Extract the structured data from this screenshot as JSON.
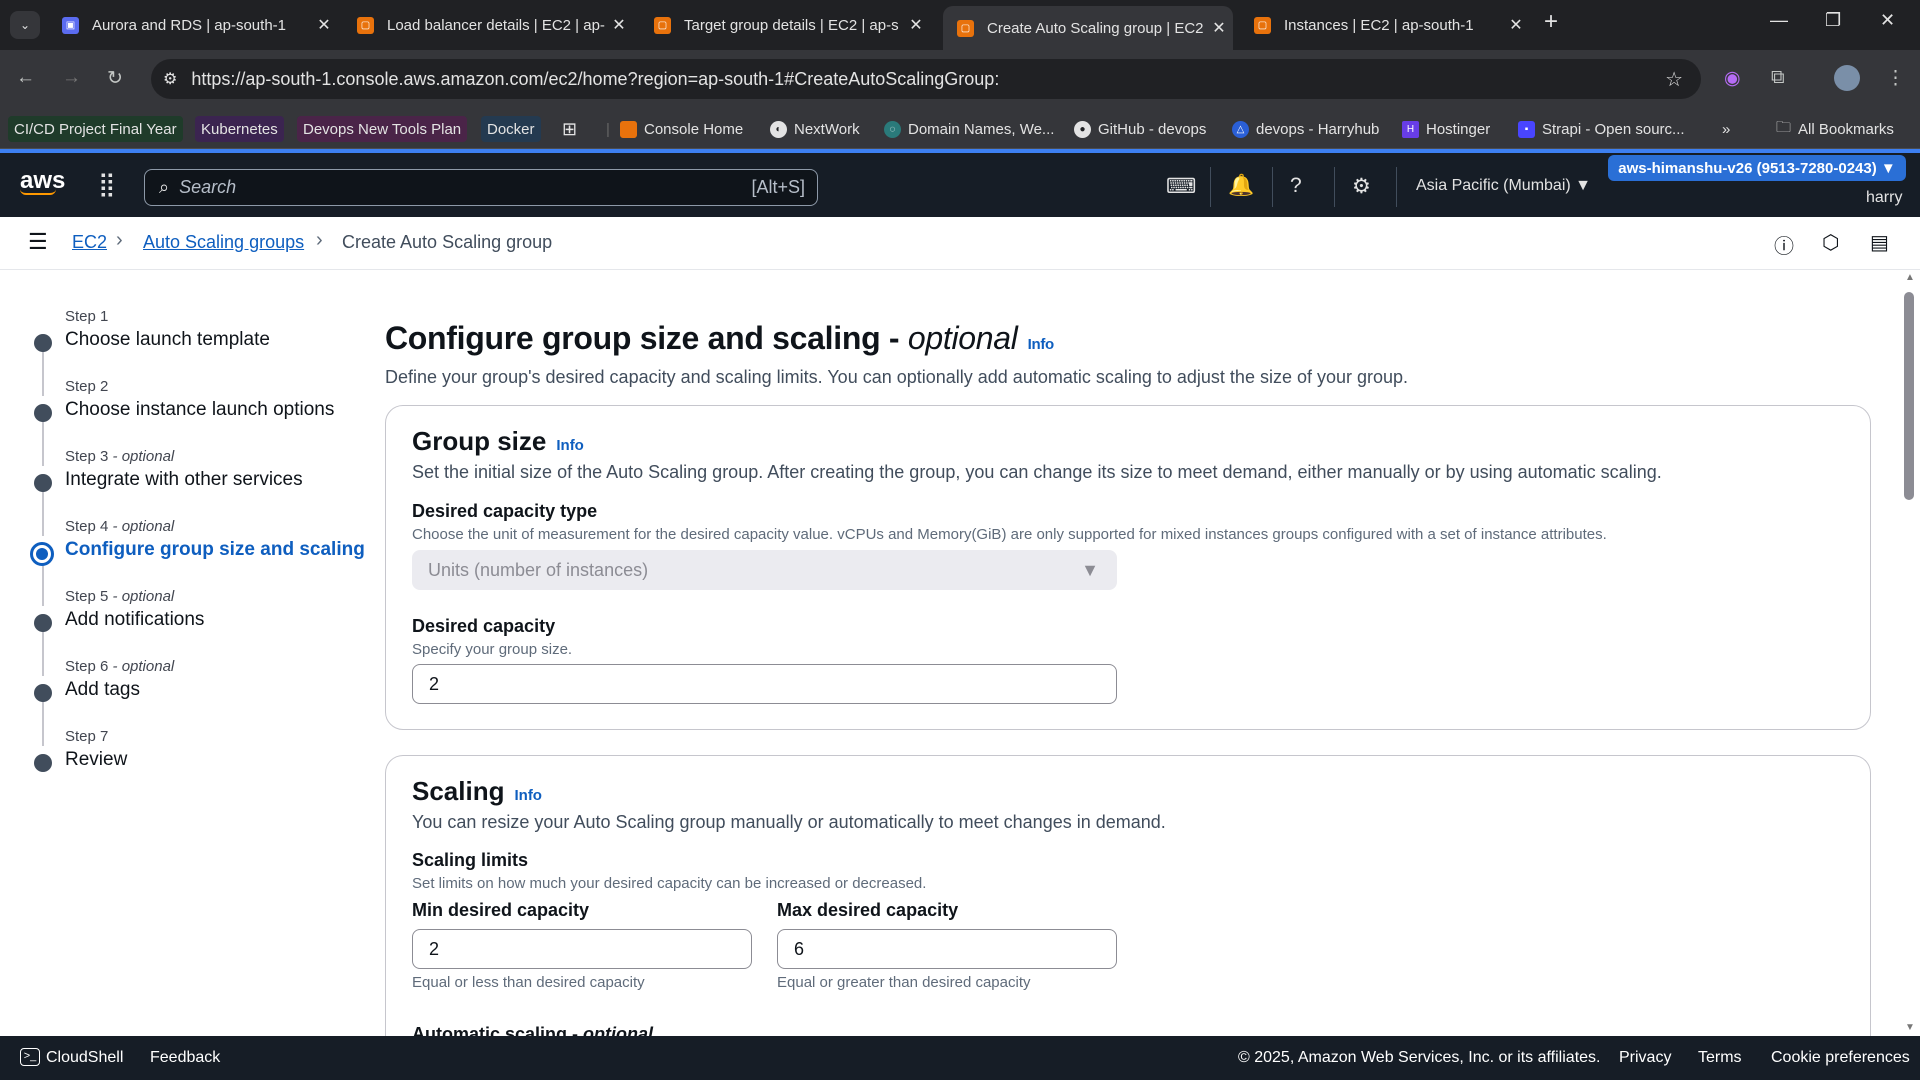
{
  "browser": {
    "tabs": [
      {
        "title": "Aurora and RDS | ap-south-1",
        "active": false,
        "icon": "rds-icon"
      },
      {
        "title": "Load balancer details | EC2 | ap-s",
        "active": false,
        "icon": "ec2-icon"
      },
      {
        "title": "Target group details | EC2 | ap-s",
        "active": false,
        "icon": "ec2-icon"
      },
      {
        "title": "Create Auto Scaling group | EC2",
        "active": true,
        "icon": "ec2-icon"
      },
      {
        "title": "Instances | EC2 | ap-south-1",
        "active": false,
        "icon": "ec2-icon"
      }
    ],
    "url": "https://ap-south-1.console.aws.amazon.com/ec2/home?region=ap-south-1#CreateAutoScalingGroup:",
    "bookmarks": [
      "CI/CD Project Final Year",
      "Kubernetes",
      "Devops New Tools Plan",
      "Docker",
      "Console Home",
      "NextWork",
      "Domain Names, We...",
      "GitHub - devops",
      "devops - Harryhub",
      "Hostinger",
      "Strapi - Open sourc..."
    ],
    "all_bookmarks": "All Bookmarks"
  },
  "aws": {
    "logo": "aws",
    "search_placeholder": "Search",
    "search_shortcut": "[Alt+S]",
    "region": "Asia Pacific (Mumbai)",
    "account": "aws-himanshu-v26 (9513-7280-0243)",
    "user": "harry"
  },
  "breadcrumb": {
    "items": [
      "EC2",
      "Auto Scaling groups"
    ],
    "current": "Create Auto Scaling group"
  },
  "steps": [
    {
      "label": "Step 1",
      "optional": "",
      "name": "Choose launch template"
    },
    {
      "label": "Step 2",
      "optional": "",
      "name": "Choose instance launch options"
    },
    {
      "label": "Step 3",
      "optional": " - optional",
      "name": "Integrate with other services"
    },
    {
      "label": "Step 4",
      "optional": " - optional",
      "name": "Configure group size and scaling"
    },
    {
      "label": "Step 5",
      "optional": " - optional",
      "name": "Add notifications"
    },
    {
      "label": "Step 6",
      "optional": " - optional",
      "name": "Add tags"
    },
    {
      "label": "Step 7",
      "optional": "",
      "name": "Review"
    }
  ],
  "page": {
    "title": "Configure group size and scaling - ",
    "title_italic": "optional",
    "info": "Info",
    "description": "Define your group's desired capacity and scaling limits. You can optionally add automatic scaling to adjust the size of your group."
  },
  "group_size": {
    "title": "Group size",
    "info": "Info",
    "description": "Set the initial size of the Auto Scaling group. After creating the group, you can change its size to meet demand, either manually or by using automatic scaling.",
    "capacity_type_label": "Desired capacity type",
    "capacity_type_desc": "Choose the unit of measurement for the desired capacity value. vCPUs and Memory(GiB) are only supported for mixed instances groups configured with a set of instance attributes.",
    "capacity_type_value": "Units (number of instances)",
    "desired_label": "Desired capacity",
    "desired_desc": "Specify your group size.",
    "desired_value": "2"
  },
  "scaling": {
    "title": "Scaling",
    "info": "Info",
    "description": "You can resize your Auto Scaling group manually or automatically to meet changes in demand.",
    "limits_label": "Scaling limits",
    "limits_desc": "Set limits on how much your desired capacity can be increased or decreased.",
    "min_label": "Min desired capacity",
    "min_value": "2",
    "min_hint": "Equal or less than desired capacity",
    "max_label": "Max desired capacity",
    "max_value": "6",
    "max_hint": "Equal or greater than desired capacity",
    "auto_label": "Automatic scaling - ",
    "auto_italic": "optional"
  },
  "footer": {
    "cloudshell": "CloudShell",
    "feedback": "Feedback",
    "copyright": "© 2025, Amazon Web Services, Inc. or its affiliates.",
    "privacy": "Privacy",
    "terms": "Terms",
    "cookies": "Cookie preferences"
  }
}
